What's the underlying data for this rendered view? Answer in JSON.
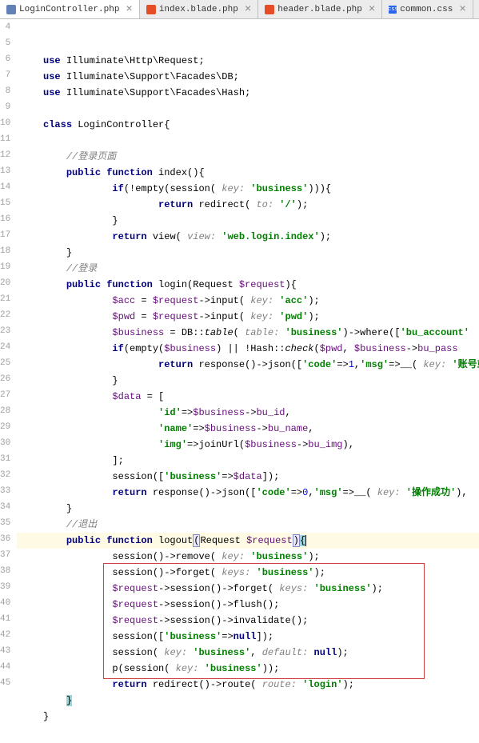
{
  "tabs": [
    {
      "name": "LoginController.php",
      "type": "php",
      "active": true
    },
    {
      "name": "index.blade.php",
      "type": "blade",
      "active": false
    },
    {
      "name": "header.blade.php",
      "type": "blade",
      "active": false
    },
    {
      "name": "common.css",
      "type": "css",
      "active": false
    }
  ],
  "lineStart": 4,
  "lineEnd": 45,
  "code": {
    "l4": {
      "indent": 0,
      "tokens": [
        {
          "t": "kw",
          "v": "use "
        },
        {
          "t": "cls",
          "v": "Illuminate\\Http\\Request;"
        }
      ]
    },
    "l5": {
      "indent": 0,
      "tokens": [
        {
          "t": "kw",
          "v": "use "
        },
        {
          "t": "cls",
          "v": "Illuminate\\Support\\Facades\\DB;"
        }
      ]
    },
    "l6": {
      "indent": 0,
      "tokens": [
        {
          "t": "kw",
          "v": "use "
        },
        {
          "t": "cls",
          "v": "Illuminate\\Support\\Facades\\Hash;"
        }
      ]
    },
    "l7": {
      "indent": 0,
      "tokens": []
    },
    "l8": {
      "indent": 0,
      "tokens": [
        {
          "t": "kw",
          "v": "class "
        },
        {
          "t": "cls",
          "v": "LoginController"
        },
        {
          "t": "",
          "v": "{"
        }
      ]
    },
    "l9": {
      "indent": 0,
      "tokens": []
    },
    "l10": {
      "indent": 2,
      "tokens": [
        {
          "t": "comment",
          "v": "//登录页面"
        }
      ]
    },
    "l11": {
      "indent": 2,
      "tokens": [
        {
          "t": "kw",
          "v": "public function "
        },
        {
          "t": "fn",
          "v": "index"
        },
        {
          "t": "",
          "v": "(){"
        }
      ]
    },
    "l12": {
      "indent": 4,
      "tokens": [
        {
          "t": "kw",
          "v": "if"
        },
        {
          "t": "",
          "v": "(!"
        },
        {
          "t": "fn",
          "v": "empty"
        },
        {
          "t": "",
          "v": "("
        },
        {
          "t": "fn",
          "v": "session"
        },
        {
          "t": "",
          "v": "( "
        },
        {
          "t": "hint",
          "v": "key: "
        },
        {
          "t": "str",
          "v": "'business'"
        },
        {
          "t": "",
          "v": "))){"
        }
      ]
    },
    "l13": {
      "indent": 6,
      "tokens": [
        {
          "t": "kw",
          "v": "return "
        },
        {
          "t": "fn",
          "v": "redirect"
        },
        {
          "t": "",
          "v": "( "
        },
        {
          "t": "hint",
          "v": "to: "
        },
        {
          "t": "str",
          "v": "'/'"
        },
        {
          "t": "",
          "v": ");"
        }
      ]
    },
    "l14": {
      "indent": 4,
      "tokens": [
        {
          "t": "",
          "v": "}"
        }
      ]
    },
    "l15": {
      "indent": 4,
      "tokens": [
        {
          "t": "kw",
          "v": "return "
        },
        {
          "t": "fn",
          "v": "view"
        },
        {
          "t": "",
          "v": "( "
        },
        {
          "t": "hint",
          "v": "view: "
        },
        {
          "t": "str",
          "v": "'web.login.index'"
        },
        {
          "t": "",
          "v": ");"
        }
      ]
    },
    "l16": {
      "indent": 2,
      "tokens": [
        {
          "t": "",
          "v": "}"
        }
      ]
    },
    "l17": {
      "indent": 2,
      "tokens": [
        {
          "t": "comment",
          "v": "//登录"
        }
      ]
    },
    "l18": {
      "indent": 2,
      "tokens": [
        {
          "t": "kw",
          "v": "public function "
        },
        {
          "t": "fn",
          "v": "login"
        },
        {
          "t": "",
          "v": "(Request "
        },
        {
          "t": "var",
          "v": "$request"
        },
        {
          "t": "",
          "v": "){"
        }
      ]
    },
    "l19": {
      "indent": 4,
      "tokens": [
        {
          "t": "var",
          "v": "$acc"
        },
        {
          "t": "",
          "v": " = "
        },
        {
          "t": "var",
          "v": "$request"
        },
        {
          "t": "",
          "v": "->"
        },
        {
          "t": "method",
          "v": "input"
        },
        {
          "t": "",
          "v": "( "
        },
        {
          "t": "hint",
          "v": "key: "
        },
        {
          "t": "str",
          "v": "'acc'"
        },
        {
          "t": "",
          "v": ");"
        }
      ]
    },
    "l20": {
      "indent": 4,
      "tokens": [
        {
          "t": "var",
          "v": "$pwd"
        },
        {
          "t": "",
          "v": " = "
        },
        {
          "t": "var",
          "v": "$request"
        },
        {
          "t": "",
          "v": "->"
        },
        {
          "t": "method",
          "v": "input"
        },
        {
          "t": "",
          "v": "( "
        },
        {
          "t": "hint",
          "v": "key: "
        },
        {
          "t": "str",
          "v": "'pwd'"
        },
        {
          "t": "",
          "v": ");"
        }
      ]
    },
    "l21": {
      "indent": 4,
      "tokens": [
        {
          "t": "var",
          "v": "$business"
        },
        {
          "t": "",
          "v": " = DB::"
        },
        {
          "t": "static",
          "v": "table"
        },
        {
          "t": "",
          "v": "( "
        },
        {
          "t": "hint",
          "v": "table: "
        },
        {
          "t": "str",
          "v": "'business'"
        },
        {
          "t": "",
          "v": ")->"
        },
        {
          "t": "method",
          "v": "where"
        },
        {
          "t": "",
          "v": "(["
        },
        {
          "t": "str",
          "v": "'bu_account'"
        }
      ]
    },
    "l22": {
      "indent": 4,
      "tokens": [
        {
          "t": "kw",
          "v": "if"
        },
        {
          "t": "",
          "v": "("
        },
        {
          "t": "fn",
          "v": "empty"
        },
        {
          "t": "",
          "v": "("
        },
        {
          "t": "var",
          "v": "$business"
        },
        {
          "t": "",
          "v": ") || !Hash::"
        },
        {
          "t": "static",
          "v": "check"
        },
        {
          "t": "",
          "v": "("
        },
        {
          "t": "var",
          "v": "$pwd"
        },
        {
          "t": "",
          "v": ", "
        },
        {
          "t": "var",
          "v": "$business"
        },
        {
          "t": "",
          "v": "->"
        },
        {
          "t": "prop",
          "v": "bu_pass"
        }
      ]
    },
    "l23": {
      "indent": 6,
      "tokens": [
        {
          "t": "kw",
          "v": "return "
        },
        {
          "t": "fn",
          "v": "response"
        },
        {
          "t": "",
          "v": "()->"
        },
        {
          "t": "method",
          "v": "json"
        },
        {
          "t": "",
          "v": "(["
        },
        {
          "t": "str",
          "v": "'code'"
        },
        {
          "t": "",
          "v": "=>"
        },
        {
          "t": "num",
          "v": "1"
        },
        {
          "t": "",
          "v": ","
        },
        {
          "t": "str",
          "v": "'msg'"
        },
        {
          "t": "",
          "v": "=>__( "
        },
        {
          "t": "hint",
          "v": "key: "
        },
        {
          "t": "str",
          "v": "'账号或"
        }
      ]
    },
    "l24": {
      "indent": 4,
      "tokens": [
        {
          "t": "",
          "v": "}"
        }
      ]
    },
    "l25": {
      "indent": 4,
      "tokens": [
        {
          "t": "var",
          "v": "$data"
        },
        {
          "t": "",
          "v": " = ["
        }
      ]
    },
    "l26": {
      "indent": 6,
      "tokens": [
        {
          "t": "str",
          "v": "'id'"
        },
        {
          "t": "",
          "v": "=>"
        },
        {
          "t": "var",
          "v": "$business"
        },
        {
          "t": "",
          "v": "->"
        },
        {
          "t": "prop",
          "v": "bu_id"
        },
        {
          "t": "",
          "v": ","
        }
      ]
    },
    "l27": {
      "indent": 6,
      "tokens": [
        {
          "t": "str",
          "v": "'name'"
        },
        {
          "t": "",
          "v": "=>"
        },
        {
          "t": "var",
          "v": "$business"
        },
        {
          "t": "",
          "v": "->"
        },
        {
          "t": "prop",
          "v": "bu_name"
        },
        {
          "t": "",
          "v": ","
        }
      ]
    },
    "l28": {
      "indent": 6,
      "tokens": [
        {
          "t": "str",
          "v": "'img'"
        },
        {
          "t": "",
          "v": "=>"
        },
        {
          "t": "fn",
          "v": "joinUrl"
        },
        {
          "t": "",
          "v": "("
        },
        {
          "t": "var",
          "v": "$business"
        },
        {
          "t": "",
          "v": "->"
        },
        {
          "t": "prop",
          "v": "bu_img"
        },
        {
          "t": "",
          "v": "),"
        }
      ]
    },
    "l29": {
      "indent": 4,
      "tokens": [
        {
          "t": "",
          "v": "];"
        }
      ]
    },
    "l30": {
      "indent": 4,
      "tokens": [
        {
          "t": "fn",
          "v": "session"
        },
        {
          "t": "",
          "v": "(["
        },
        {
          "t": "str",
          "v": "'business'"
        },
        {
          "t": "",
          "v": "=>"
        },
        {
          "t": "var",
          "v": "$data"
        },
        {
          "t": "",
          "v": "]);"
        }
      ]
    },
    "l31": {
      "indent": 4,
      "tokens": [
        {
          "t": "kw",
          "v": "return "
        },
        {
          "t": "fn",
          "v": "response"
        },
        {
          "t": "",
          "v": "()->"
        },
        {
          "t": "method",
          "v": "json"
        },
        {
          "t": "",
          "v": "(["
        },
        {
          "t": "str",
          "v": "'code'"
        },
        {
          "t": "",
          "v": "=>"
        },
        {
          "t": "num",
          "v": "0"
        },
        {
          "t": "",
          "v": ","
        },
        {
          "t": "str",
          "v": "'msg'"
        },
        {
          "t": "",
          "v": "=>__( "
        },
        {
          "t": "hint",
          "v": "key: "
        },
        {
          "t": "str",
          "v": "'操作成功'"
        },
        {
          "t": "",
          "v": "),"
        }
      ]
    },
    "l32": {
      "indent": 2,
      "tokens": [
        {
          "t": "",
          "v": "}"
        }
      ]
    },
    "l33": {
      "indent": 2,
      "tokens": [
        {
          "t": "comment",
          "v": "//退出"
        }
      ]
    },
    "l34": {
      "indent": 2,
      "current": true,
      "tokens": [
        {
          "t": "kw",
          "v": "public function "
        },
        {
          "t": "fn",
          "v": "logout"
        },
        {
          "t": "brace-match",
          "v": "("
        },
        {
          "t": "",
          "v": "Request "
        },
        {
          "t": "var",
          "v": "$request"
        },
        {
          "t": "brace-match",
          "v": ")"
        },
        {
          "t": "brace-cur",
          "v": "{"
        },
        {
          "t": "cursor",
          "v": ""
        }
      ]
    },
    "l35": {
      "indent": 4,
      "tokens": [
        {
          "t": "fn",
          "v": "session"
        },
        {
          "t": "",
          "v": "()->"
        },
        {
          "t": "method",
          "v": "remove"
        },
        {
          "t": "",
          "v": "( "
        },
        {
          "t": "hint",
          "v": "key: "
        },
        {
          "t": "str",
          "v": "'business'"
        },
        {
          "t": "",
          "v": ");"
        }
      ]
    },
    "l36": {
      "indent": 4,
      "tokens": [
        {
          "t": "fn",
          "v": "session"
        },
        {
          "t": "",
          "v": "()->"
        },
        {
          "t": "method",
          "v": "forget"
        },
        {
          "t": "",
          "v": "( "
        },
        {
          "t": "hint",
          "v": "keys: "
        },
        {
          "t": "str",
          "v": "'business'"
        },
        {
          "t": "",
          "v": ");"
        }
      ]
    },
    "l37": {
      "indent": 4,
      "tokens": [
        {
          "t": "var",
          "v": "$request"
        },
        {
          "t": "",
          "v": "->"
        },
        {
          "t": "method",
          "v": "session"
        },
        {
          "t": "",
          "v": "()->"
        },
        {
          "t": "method",
          "v": "forget"
        },
        {
          "t": "",
          "v": "( "
        },
        {
          "t": "hint",
          "v": "keys: "
        },
        {
          "t": "str",
          "v": "'business'"
        },
        {
          "t": "",
          "v": ");"
        }
      ]
    },
    "l38": {
      "indent": 4,
      "tokens": [
        {
          "t": "var",
          "v": "$request"
        },
        {
          "t": "",
          "v": "->"
        },
        {
          "t": "method",
          "v": "session"
        },
        {
          "t": "",
          "v": "()->"
        },
        {
          "t": "method",
          "v": "flush"
        },
        {
          "t": "",
          "v": "();"
        }
      ]
    },
    "l39": {
      "indent": 4,
      "tokens": [
        {
          "t": "var",
          "v": "$request"
        },
        {
          "t": "",
          "v": "->"
        },
        {
          "t": "method",
          "v": "session"
        },
        {
          "t": "",
          "v": "()->"
        },
        {
          "t": "method",
          "v": "invalidate"
        },
        {
          "t": "",
          "v": "();"
        }
      ]
    },
    "l40": {
      "indent": 4,
      "tokens": [
        {
          "t": "fn",
          "v": "session"
        },
        {
          "t": "",
          "v": "(["
        },
        {
          "t": "str",
          "v": "'business'"
        },
        {
          "t": "",
          "v": "=>"
        },
        {
          "t": "kw",
          "v": "null"
        },
        {
          "t": "",
          "v": "]);"
        }
      ]
    },
    "l41": {
      "indent": 4,
      "tokens": [
        {
          "t": "fn",
          "v": "session"
        },
        {
          "t": "",
          "v": "( "
        },
        {
          "t": "hint",
          "v": "key: "
        },
        {
          "t": "str",
          "v": "'business'"
        },
        {
          "t": "",
          "v": ", "
        },
        {
          "t": "hint",
          "v": "default: "
        },
        {
          "t": "kw",
          "v": "null"
        },
        {
          "t": "",
          "v": ");"
        }
      ]
    },
    "l42": {
      "indent": 4,
      "tokens": [
        {
          "t": "fn",
          "v": "p"
        },
        {
          "t": "",
          "v": "("
        },
        {
          "t": "fn",
          "v": "session"
        },
        {
          "t": "",
          "v": "( "
        },
        {
          "t": "hint",
          "v": "key: "
        },
        {
          "t": "str",
          "v": "'business'"
        },
        {
          "t": "",
          "v": "));"
        }
      ]
    },
    "l43": {
      "indent": 4,
      "tokens": [
        {
          "t": "kw",
          "v": "return "
        },
        {
          "t": "fn",
          "v": "redirect"
        },
        {
          "t": "",
          "v": "()->"
        },
        {
          "t": "method",
          "v": "route"
        },
        {
          "t": "",
          "v": "( "
        },
        {
          "t": "hint",
          "v": "route: "
        },
        {
          "t": "str",
          "v": "'login'"
        },
        {
          "t": "",
          "v": ");"
        }
      ]
    },
    "l44": {
      "indent": 2,
      "tokens": [
        {
          "t": "brace-cur",
          "v": "}"
        }
      ]
    },
    "l45": {
      "indent": 0,
      "tokens": [
        {
          "t": "",
          "v": "}"
        }
      ]
    }
  },
  "foldMarks": [
    8,
    11,
    12,
    18,
    22,
    25,
    34
  ],
  "cssLabel": "css"
}
